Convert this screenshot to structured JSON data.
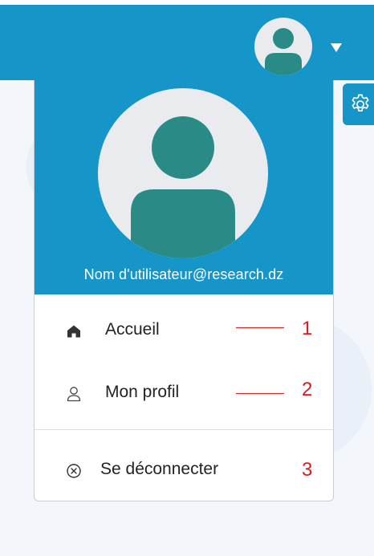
{
  "header": {
    "avatar_alt": "user-avatar",
    "menu_caret": "caret-down"
  },
  "dropdown": {
    "username": "Nom d'utilisateur@research.dz",
    "items": [
      {
        "label": "Accueil",
        "icon": "home-icon"
      },
      {
        "label": "Mon profil",
        "icon": "user-icon"
      },
      {
        "label": "Se déconnecter",
        "icon": "close-circle-icon"
      }
    ]
  },
  "annotations": [
    "1",
    "2",
    "3"
  ],
  "colors": {
    "brand_blue": "#1695c9",
    "avatar_teal": "#2a8a86",
    "avatar_bg": "#e9ebee",
    "annotation_red": "#e0191b"
  }
}
